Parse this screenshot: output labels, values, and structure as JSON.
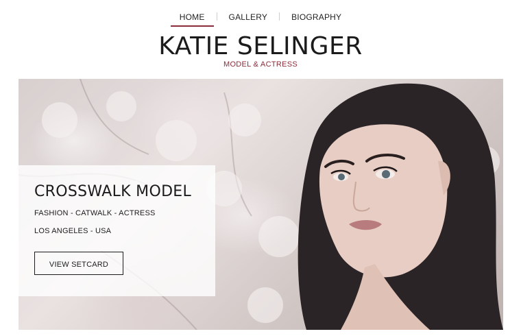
{
  "nav": {
    "items": [
      {
        "label": "HOME",
        "active": true
      },
      {
        "label": "GALLERY",
        "active": false
      },
      {
        "label": "BIOGRAPHY",
        "active": false
      }
    ]
  },
  "header": {
    "title": "KATIE SELINGER",
    "subtitle": "MODEL & ACTRESS"
  },
  "hero": {
    "card": {
      "heading": "CROSSWALK MODEL",
      "line1": "FASHION - CATWALK - ACTRESS",
      "line2": "LOS ANGELES - USA",
      "button_label": "VIEW SETCARD"
    }
  },
  "colors": {
    "accent": "#8a2b3a",
    "text": "#1b1b1b"
  }
}
